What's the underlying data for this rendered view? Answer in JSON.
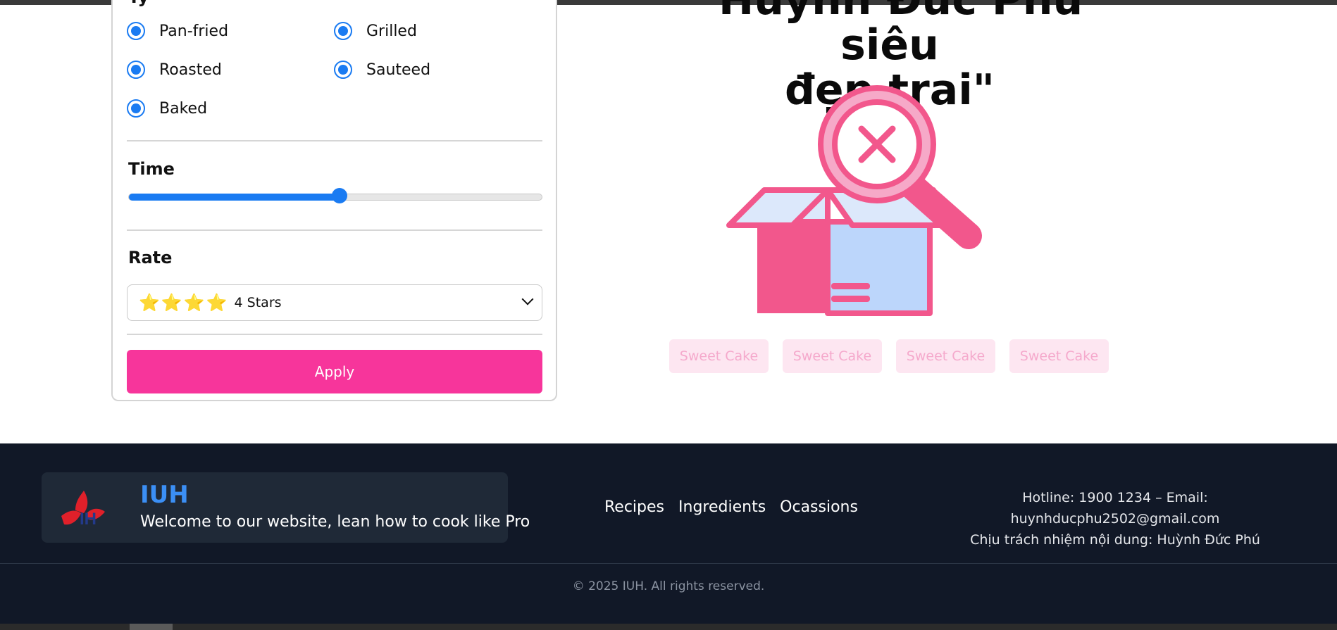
{
  "filters": {
    "cooking_types": [
      {
        "label": "Pan-fried",
        "checked": true
      },
      {
        "label": "Grilled",
        "checked": true
      },
      {
        "label": "Roasted",
        "checked": true
      },
      {
        "label": "Sauteed",
        "checked": true
      },
      {
        "label": "Baked",
        "checked": true
      }
    ],
    "time": {
      "title": "Time",
      "value_fraction": 0.51
    },
    "rate": {
      "title": "Rate",
      "selected_stars": "⭐⭐⭐⭐",
      "selected_label": "4 Stars"
    },
    "apply_label": "Apply"
  },
  "results": {
    "title_line1": "\"Huỳnh Đức Phú siêu",
    "title_line2": "đẹp trai\"",
    "empty_icon": "box-magnifier-not-found-icon",
    "tags": [
      "Sweet Cake",
      "Sweet Cake",
      "Sweet Cake",
      "Sweet Cake"
    ]
  },
  "footer": {
    "brand_name": "IUH",
    "tagline": "Welcome to our website, lean how to cook like Pro",
    "nav": [
      "Recipes",
      "Ingredients",
      "Ocassions"
    ],
    "contact_line1": "Hotline: 1900 1234 – Email: huynhducphu2502@gmail.com",
    "contact_line2": "Chịu trách nhiệm nội dung: Huỳnh Đức Phú",
    "copyright": "© 2025 IUH. All rights reserved."
  },
  "colors": {
    "accent_pink": "#f7359b",
    "radio_blue": "#1a7bf2",
    "footer_bg": "#111827",
    "brand_blue": "#3b8ff5"
  }
}
